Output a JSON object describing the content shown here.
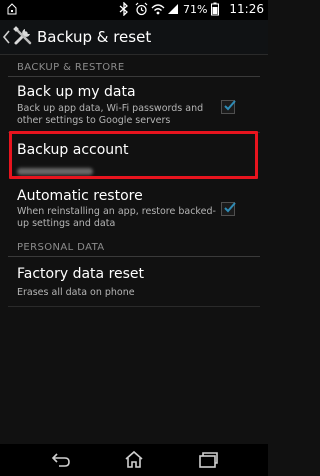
{
  "status_bar": {
    "battery_percent": "71%",
    "time": "11:26",
    "icons": [
      "usb-debug-icon",
      "bluetooth-icon",
      "alarm-icon",
      "wifi-icon",
      "signal-icon",
      "battery-icon"
    ]
  },
  "action_bar": {
    "title": "Backup & reset",
    "icon": "settings-tools-icon"
  },
  "sections": {
    "backup_restore": "BACKUP & RESTORE",
    "personal_data": "PERSONAL DATA"
  },
  "items": {
    "backup_data": {
      "title": "Back up my data",
      "subtitle": "Back up app data, Wi-Fi passwords and other settings to Google servers",
      "checked": true
    },
    "backup_account": {
      "title": "Backup account"
    },
    "auto_restore": {
      "title": "Automatic restore",
      "subtitle": "When reinstalling an app, restore backed-up settings and data",
      "checked": true
    },
    "factory_reset": {
      "title": "Factory data reset",
      "subtitle": "Erases all data on phone"
    }
  },
  "colors": {
    "highlight": "#e8141e",
    "checkbox_tick": "#2e8bb5"
  },
  "nav_bar": {
    "buttons": [
      "back-icon",
      "home-icon",
      "recent-apps-icon"
    ]
  }
}
